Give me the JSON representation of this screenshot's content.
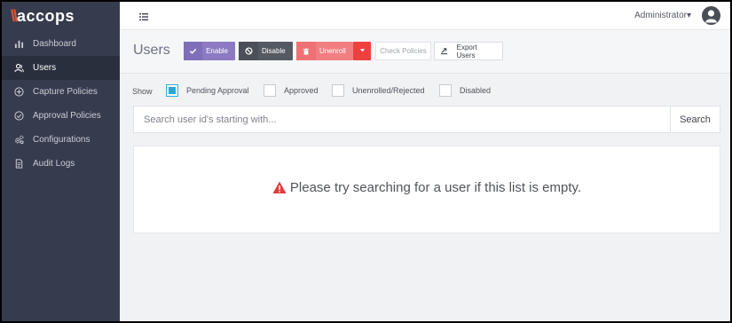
{
  "brand": {
    "mark": "\\\\",
    "name": "accops"
  },
  "sidebar": {
    "items": [
      {
        "label": "Dashboard",
        "icon": "bar-chart-icon",
        "active": false
      },
      {
        "label": "Users",
        "icon": "users-icon",
        "active": true
      },
      {
        "label": "Capture Policies",
        "icon": "plus-circle-icon",
        "active": false
      },
      {
        "label": "Approval Policies",
        "icon": "check-circle-icon",
        "active": false
      },
      {
        "label": "Configurations",
        "icon": "gears-icon",
        "active": false
      },
      {
        "label": "Audit Logs",
        "icon": "document-icon",
        "active": false
      }
    ]
  },
  "topbar": {
    "menu_icon": "list-menu-icon",
    "user_label": "Administrator",
    "caret": "▾",
    "avatar_icon": "user-avatar-icon"
  },
  "header": {
    "title": "Users",
    "buttons": {
      "enable": "Enable",
      "disable": "Disable",
      "unenroll": "Unenroll",
      "check_policies": "Check Policies",
      "export_users": "Export Users"
    }
  },
  "filters": {
    "show_label": "Show",
    "options": [
      {
        "label": "Pending Approval",
        "checked": true
      },
      {
        "label": "Approved",
        "checked": false
      },
      {
        "label": "Unenrolled/Rejected",
        "checked": false
      },
      {
        "label": "Disabled",
        "checked": false
      }
    ]
  },
  "search": {
    "placeholder": "Search user id's starting with...",
    "value": "",
    "button": "Search"
  },
  "empty": {
    "message": "Please try searching for a user if this list is empty."
  },
  "colors": {
    "sidebar": "#363c4e",
    "accent_orange": "#e8542e",
    "enable": "#8c7bc3",
    "disable": "#555a62",
    "unenroll": "#f17f82",
    "danger": "#ef4040",
    "checkbox_checked": "#2aa8d8",
    "warning_icon": "#e03c3c"
  }
}
